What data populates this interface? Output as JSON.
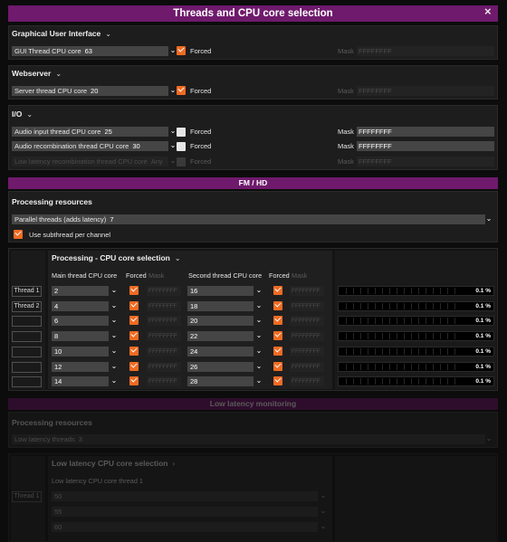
{
  "title": "Threads and CPU core selection",
  "close": "×",
  "gui": {
    "header": "Graphical User Interface",
    "label": "GUI Thread CPU core",
    "value": "63",
    "forced": "Forced",
    "mask_label": "Mask",
    "mask": "FFFFFFFF"
  },
  "web": {
    "header": "Webserver",
    "label": "Server thread CPU core",
    "value": "20",
    "forced": "Forced",
    "mask_label": "Mask",
    "mask": "FFFFFFFF"
  },
  "io": {
    "header": "I/O",
    "rows": [
      {
        "label": "Audio input thread CPU core",
        "value": "25",
        "forced": "Forced",
        "mask_label": "Mask",
        "mask": "FFFFFFFF"
      },
      {
        "label": "Audio recombination thread CPU core",
        "value": "30",
        "forced": "Forced",
        "mask_label": "Mask",
        "mask": "FFFFFFFF"
      },
      {
        "label": "Low latency recombination thread CPU core",
        "value": "Any",
        "forced": "Forced",
        "mask_label": "Mask",
        "mask": "FFFFFFFF"
      }
    ]
  },
  "fm": {
    "bar": "FM / HD",
    "resources": "Processing resources",
    "parallel_label": "Parallel threads (adds latency)",
    "parallel_value": "7",
    "subthread": "Use subthread per channel"
  },
  "processing": {
    "header": "Processing - CPU core selection",
    "col_main": "Main thread CPU core",
    "col_forced": "Forced",
    "col_mask": "Mask",
    "col_second": "Second thread CPU core",
    "col_forced2": "Forced",
    "col_mask2": "Mask",
    "threads": [
      "Thread 1",
      "Thread 2",
      "",
      "",
      "",
      "",
      ""
    ],
    "rows": [
      {
        "main": "2",
        "mask1": "FFFFFFFF",
        "second": "16",
        "mask2": "FFFFFFFF",
        "load": "0.1 %"
      },
      {
        "main": "4",
        "mask1": "FFFFFFFF",
        "second": "18",
        "mask2": "FFFFFFFF",
        "load": "0.1 %"
      },
      {
        "main": "6",
        "mask1": "FFFFFFFF",
        "second": "20",
        "mask2": "FFFFFFFF",
        "load": "0.1 %"
      },
      {
        "main": "8",
        "mask1": "FFFFFFFF",
        "second": "22",
        "mask2": "FFFFFFFF",
        "load": "0.1 %"
      },
      {
        "main": "10",
        "mask1": "FFFFFFFF",
        "second": "24",
        "mask2": "FFFFFFFF",
        "load": "0.1 %"
      },
      {
        "main": "12",
        "mask1": "FFFFFFFF",
        "second": "26",
        "mask2": "FFFFFFFF",
        "load": "0.1 %"
      },
      {
        "main": "14",
        "mask1": "FFFFFFFF",
        "second": "28",
        "mask2": "FFFFFFFF",
        "load": "0.1 %"
      }
    ]
  },
  "lowlat": {
    "bar": "Low latency monitoring",
    "resources": "Processing resources",
    "threads_label": "Low latency threads",
    "threads_value": "3",
    "cpu_header": "Low latency CPU core selection",
    "col": "Low latency CPU core thread 1",
    "thread": "Thread 1",
    "values": [
      "50",
      "55",
      "60"
    ]
  },
  "colors": {
    "accent": "#ef6b23",
    "bar": "#6f1a6c",
    "panel": "#1d1d1d"
  }
}
